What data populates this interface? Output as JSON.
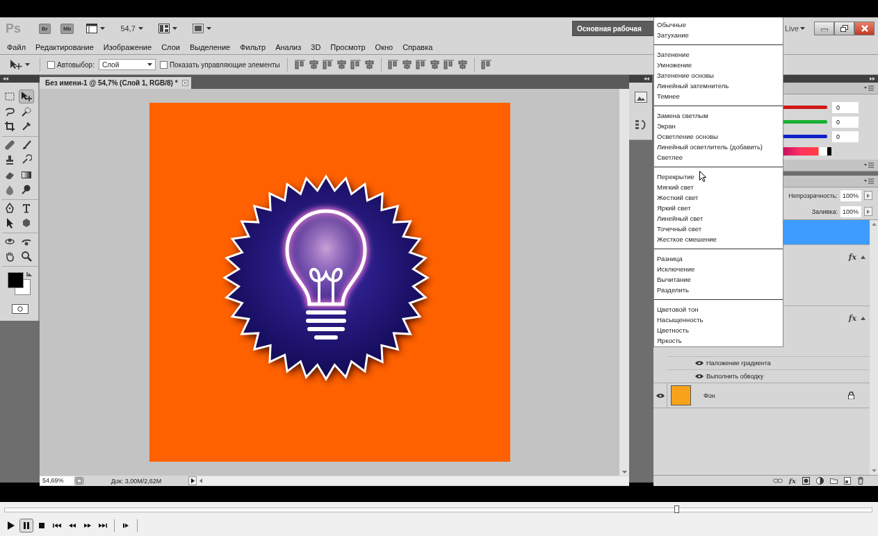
{
  "app_bar": {
    "logo": "Ps",
    "bridge": "Br",
    "mini_bridge": "Mb",
    "zoom": "54,7",
    "workspace": "Основная рабочая",
    "live": "Live"
  },
  "menu_bar": [
    "Файл",
    "Редактирование",
    "Изображение",
    "Слои",
    "Выделение",
    "Фильтр",
    "Анализ",
    "3D",
    "Просмотр",
    "Окно",
    "Справка"
  ],
  "options_bar": {
    "auto_select": {
      "label": "Автовыбор:",
      "checked": false
    },
    "target": {
      "value": "Слой"
    },
    "show_controls": {
      "label": "Показать управляющие элементы",
      "checked": false
    }
  },
  "tool_groups": [
    [
      {
        "kind": "marquee",
        "selected": false
      },
      {
        "kind": "move",
        "selected": true
      },
      {
        "kind": "lasso",
        "selected": false
      },
      {
        "kind": "quick",
        "selected": false
      },
      {
        "kind": "crop",
        "selected": false
      },
      {
        "kind": "eyedropper",
        "selected": false
      }
    ],
    [
      {
        "kind": "healing",
        "selected": false
      },
      {
        "kind": "brush",
        "selected": false
      },
      {
        "kind": "stamp",
        "selected": false
      },
      {
        "kind": "history",
        "selected": false
      },
      {
        "kind": "eraser",
        "selected": false
      },
      {
        "kind": "gradient",
        "selected": false
      },
      {
        "kind": "blur",
        "selected": false
      },
      {
        "kind": "dodge",
        "selected": false
      }
    ],
    [
      {
        "kind": "pen",
        "selected": false
      },
      {
        "kind": "type",
        "selected": false
      },
      {
        "kind": "path",
        "selected": false
      },
      {
        "kind": "shape",
        "selected": false
      }
    ],
    [
      {
        "kind": "rotate3d",
        "selected": false
      },
      {
        "kind": "orbit",
        "selected": false
      },
      {
        "kind": "hand",
        "selected": false
      },
      {
        "kind": "zoom",
        "selected": false
      }
    ]
  ],
  "document": {
    "tab_title": "Без имени-1 @ 54,7% (Слой 1, RGB/8) *",
    "zoom": "54,69%",
    "doc_size": "Док: 3,00M/2,62M"
  },
  "color_panel": {
    "channels": [
      {
        "color": "#d01818",
        "value": "0"
      },
      {
        "color": "#18b030",
        "value": "0"
      },
      {
        "color": "#1020c8",
        "value": "0"
      }
    ]
  },
  "layers_panel": {
    "opacity_label": "Непрозрачность:",
    "opacity": "100%",
    "fill_label": "Заливка:",
    "fill": "100%",
    "footer_fx": "fx",
    "layers": [
      {
        "kind": "plain",
        "selected": true
      },
      {
        "kind": "effects",
        "selected": false,
        "fx": "fx",
        "expanded": true
      },
      {
        "kind": "effects",
        "selected": false,
        "fx": "fx",
        "expanded": true,
        "effects": [
          {
            "name": "Наложение градиента",
            "visible": true
          },
          {
            "name": "Выполнить обводку",
            "visible": true
          }
        ]
      },
      {
        "kind": "background",
        "selected": false,
        "name": "Фон",
        "visible": true,
        "locked": true
      }
    ]
  },
  "blend_menu": {
    "groups": [
      [
        "Обычные",
        "Затухание"
      ],
      [
        "Затенение",
        "Умножение",
        "Затенение основы",
        "Линейный затемнитель",
        "Темнее"
      ],
      [
        "Замена светлым",
        "Экран",
        "Осветление основы",
        "Линейный осветлитель (добавить)",
        "Светлее"
      ],
      [
        "Перекрытие",
        "Мягкий свет",
        "Жесткий свет",
        "Яркий свет",
        "Линейный свет",
        "Точечный свет",
        "Жесткое смешение"
      ],
      [
        "Разница",
        "Исключение",
        "Вычитание",
        "Разделить"
      ],
      [
        "Цветовой тон",
        "Насыщенность",
        "Цветность",
        "Яркость"
      ]
    ]
  },
  "player": {
    "seek": {
      "level": 0.772
    },
    "buttons": [
      {
        "kind": "play",
        "pressed": false
      },
      {
        "kind": "pause",
        "pressed": true
      },
      {
        "kind": "stop",
        "pressed": false
      },
      {
        "kind": "prev",
        "pressed": false
      },
      {
        "kind": "rewind",
        "pressed": false
      },
      {
        "kind": "forward",
        "pressed": false
      },
      {
        "kind": "next",
        "pressed": false
      },
      {
        "kind": "step",
        "pressed": false
      }
    ]
  }
}
